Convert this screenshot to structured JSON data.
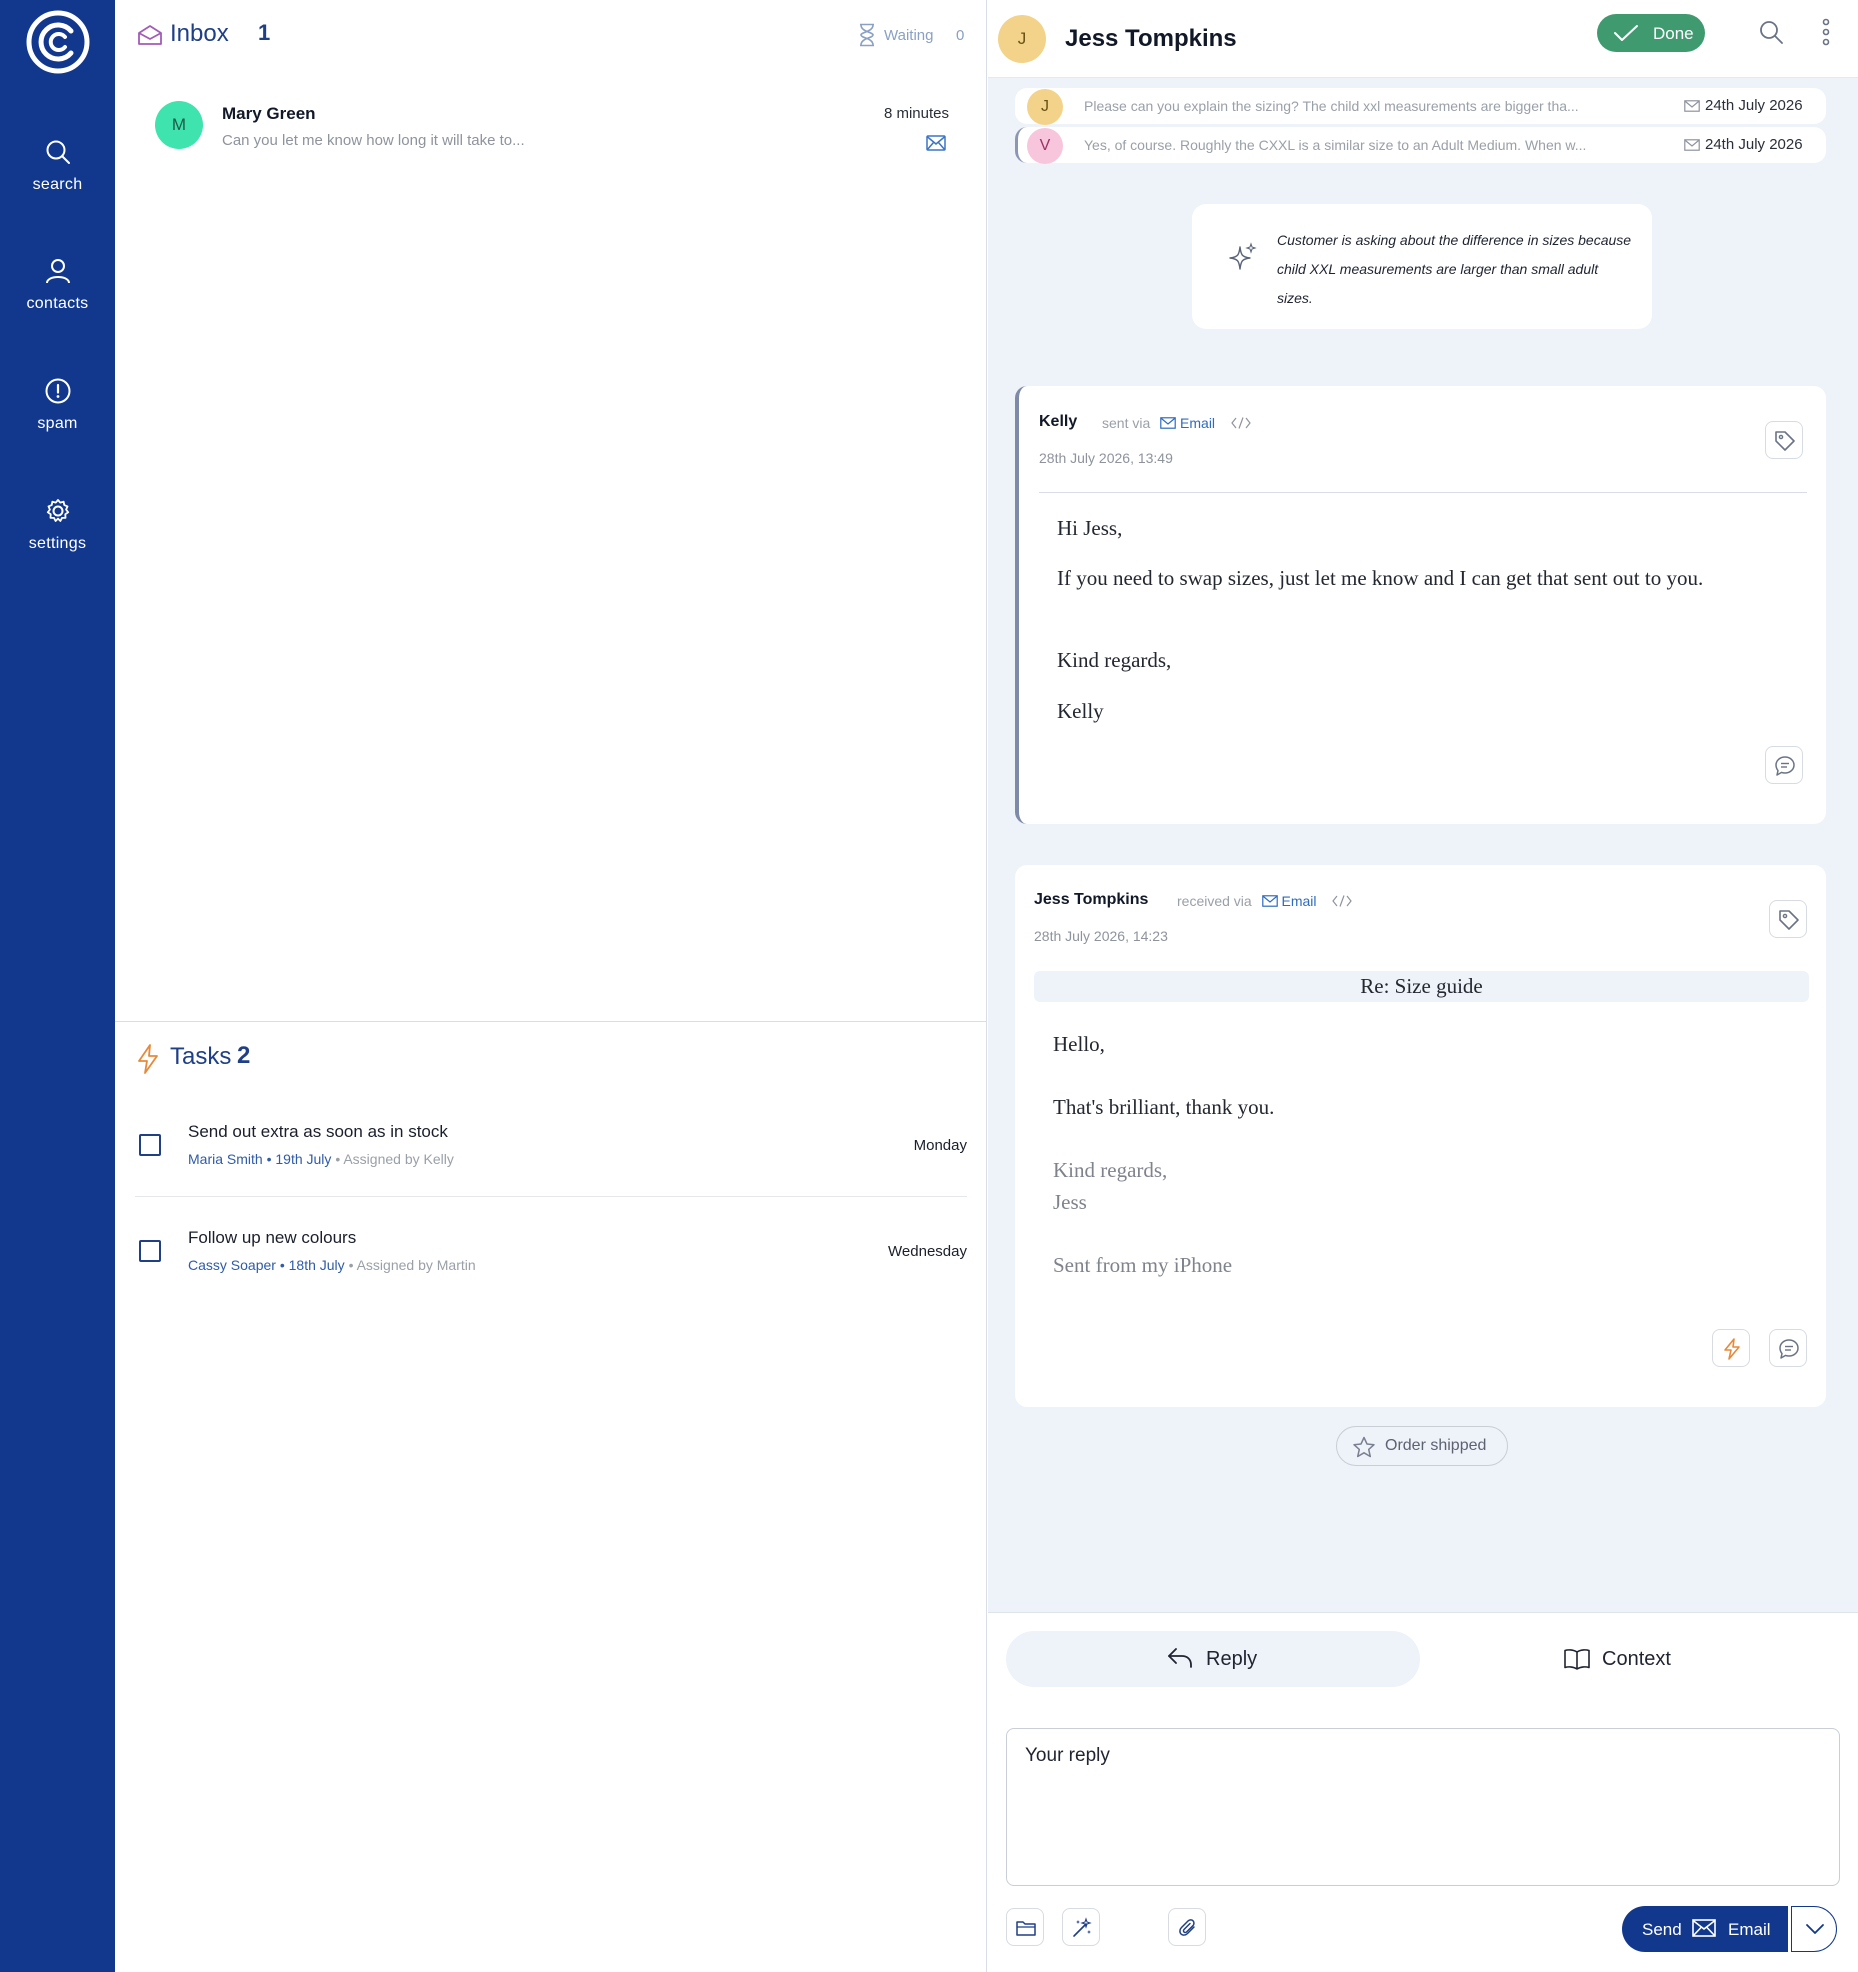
{
  "nav": {
    "items": [
      {
        "label": "search",
        "icon": "search-icon"
      },
      {
        "label": "contacts",
        "icon": "user-icon"
      },
      {
        "label": "spam",
        "icon": "alert-circle-icon"
      },
      {
        "label": "settings",
        "icon": "gear-icon"
      }
    ]
  },
  "inbox": {
    "title": "Inbox",
    "count": "1",
    "waiting_label": "Waiting",
    "waiting_count": "0",
    "conversations": [
      {
        "avatar_initial": "M",
        "name": "Mary Green",
        "preview": "Can you let me know how long it will take to...",
        "time": "8 minutes",
        "channel_icon": "mail-icon"
      }
    ]
  },
  "tasks": {
    "title": "Tasks",
    "count": "2",
    "items": [
      {
        "title": "Send out extra as soon as in stock",
        "contact": "Maria Smith",
        "date": "19th July",
        "assigned": "Assigned by Kelly",
        "due": "Monday"
      },
      {
        "title": "Follow up new colours",
        "contact": "Cassy Soaper",
        "date": "18th July",
        "assigned": "Assigned by Martin",
        "due": "Wednesday"
      }
    ]
  },
  "conversation": {
    "contact_initial": "J",
    "contact_name": "Jess Tompkins",
    "done_label": "Done",
    "thread": [
      {
        "initial": "J",
        "snippet": "Please can you explain the sizing? The child xxl measurements are bigger tha...",
        "date": "24th July 2026"
      },
      {
        "initial": "V",
        "snippet": "Yes, of course. Roughly the CXXL is a similar size to an Adult Medium.  When w...",
        "date": "24th July 2026"
      }
    ],
    "summary": "Customer is asking about the difference in sizes because child XXL measurements are larger than small adult sizes.",
    "messages": [
      {
        "from": "Kelly",
        "via_prefix": "sent via",
        "channel": "Email",
        "date": "28th July 2026, 13:49",
        "lines": [
          "Hi Jess,",
          "If you need to swap sizes, just let me know and I can get that sent out to you.",
          "Kind regards,",
          "Kelly"
        ]
      },
      {
        "from": "Jess Tompkins",
        "via_prefix": "received via",
        "channel": "Email",
        "date": "28th July 2026, 14:23",
        "subject": "Re: Size guide",
        "lines": [
          "Hello,",
          "That's brilliant, thank you.",
          "Kind regards,",
          "Jess",
          "Sent from my iPhone"
        ]
      }
    ],
    "tag_chip": "Order shipped"
  },
  "composer": {
    "reply_tab": "Reply",
    "context_tab": "Context",
    "placeholder": "Your reply",
    "send_label": "Send",
    "send_channel": "Email"
  },
  "colors": {
    "nav_bg": "#12388e",
    "accent": "#1f3f86",
    "done_green": "#3f9b6f",
    "conv_avatar": "#3fe3ad",
    "contact_avatar": "#f3d38a",
    "v_avatar": "#f7c6dc",
    "panel_bg": "#eef2f9",
    "task_icon": "#e8893a"
  }
}
